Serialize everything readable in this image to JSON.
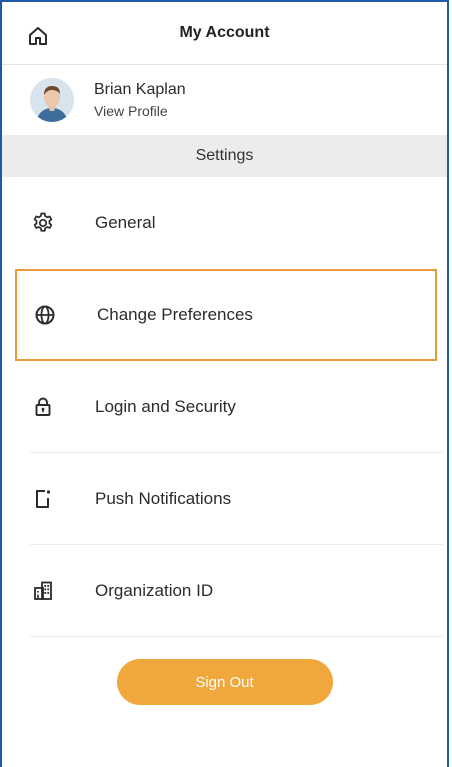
{
  "header": {
    "title": "My Account",
    "home_icon": "home-icon"
  },
  "profile": {
    "name": "Brian Kaplan",
    "link": "View Profile"
  },
  "settings": {
    "section_label": "Settings",
    "items": [
      {
        "label": "General",
        "icon": "gear-icon"
      },
      {
        "label": "Change Preferences",
        "icon": "globe-icon"
      },
      {
        "label": "Login and Security",
        "icon": "lock-icon"
      },
      {
        "label": "Push Notifications",
        "icon": "phone-notification-icon"
      },
      {
        "label": "Organization ID",
        "icon": "building-icon"
      }
    ]
  },
  "actions": {
    "sign_out": "Sign Out"
  },
  "colors": {
    "accent": "#f0a83c",
    "highlight_border": "#e89a3c",
    "frame_border": "#1e5aa8",
    "section_bg": "#ececec"
  }
}
